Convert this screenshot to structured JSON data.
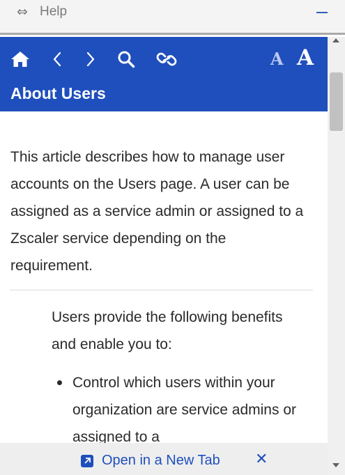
{
  "titlebar": {
    "help_label": "Help"
  },
  "toolbar": {
    "font_small_label": "A",
    "font_large_label": "A",
    "page_title": "About Users"
  },
  "content": {
    "intro": "This article describes how to manage user accounts on the Users page. A user can be assigned as a service admin or assigned to a Zscaler service depending on the requirement.",
    "benefits_intro": "Users provide the following benefits and enable you to:",
    "bullets": [
      "Control which users within your organization are service admins or assigned to a"
    ]
  },
  "bottombar": {
    "open_tab_label": "Open in a New Tab",
    "close_label": "✕"
  },
  "colors": {
    "toolbar_bg": "#1f4fbc",
    "link": "#1f4fbc",
    "text": "#2a2a2a"
  }
}
